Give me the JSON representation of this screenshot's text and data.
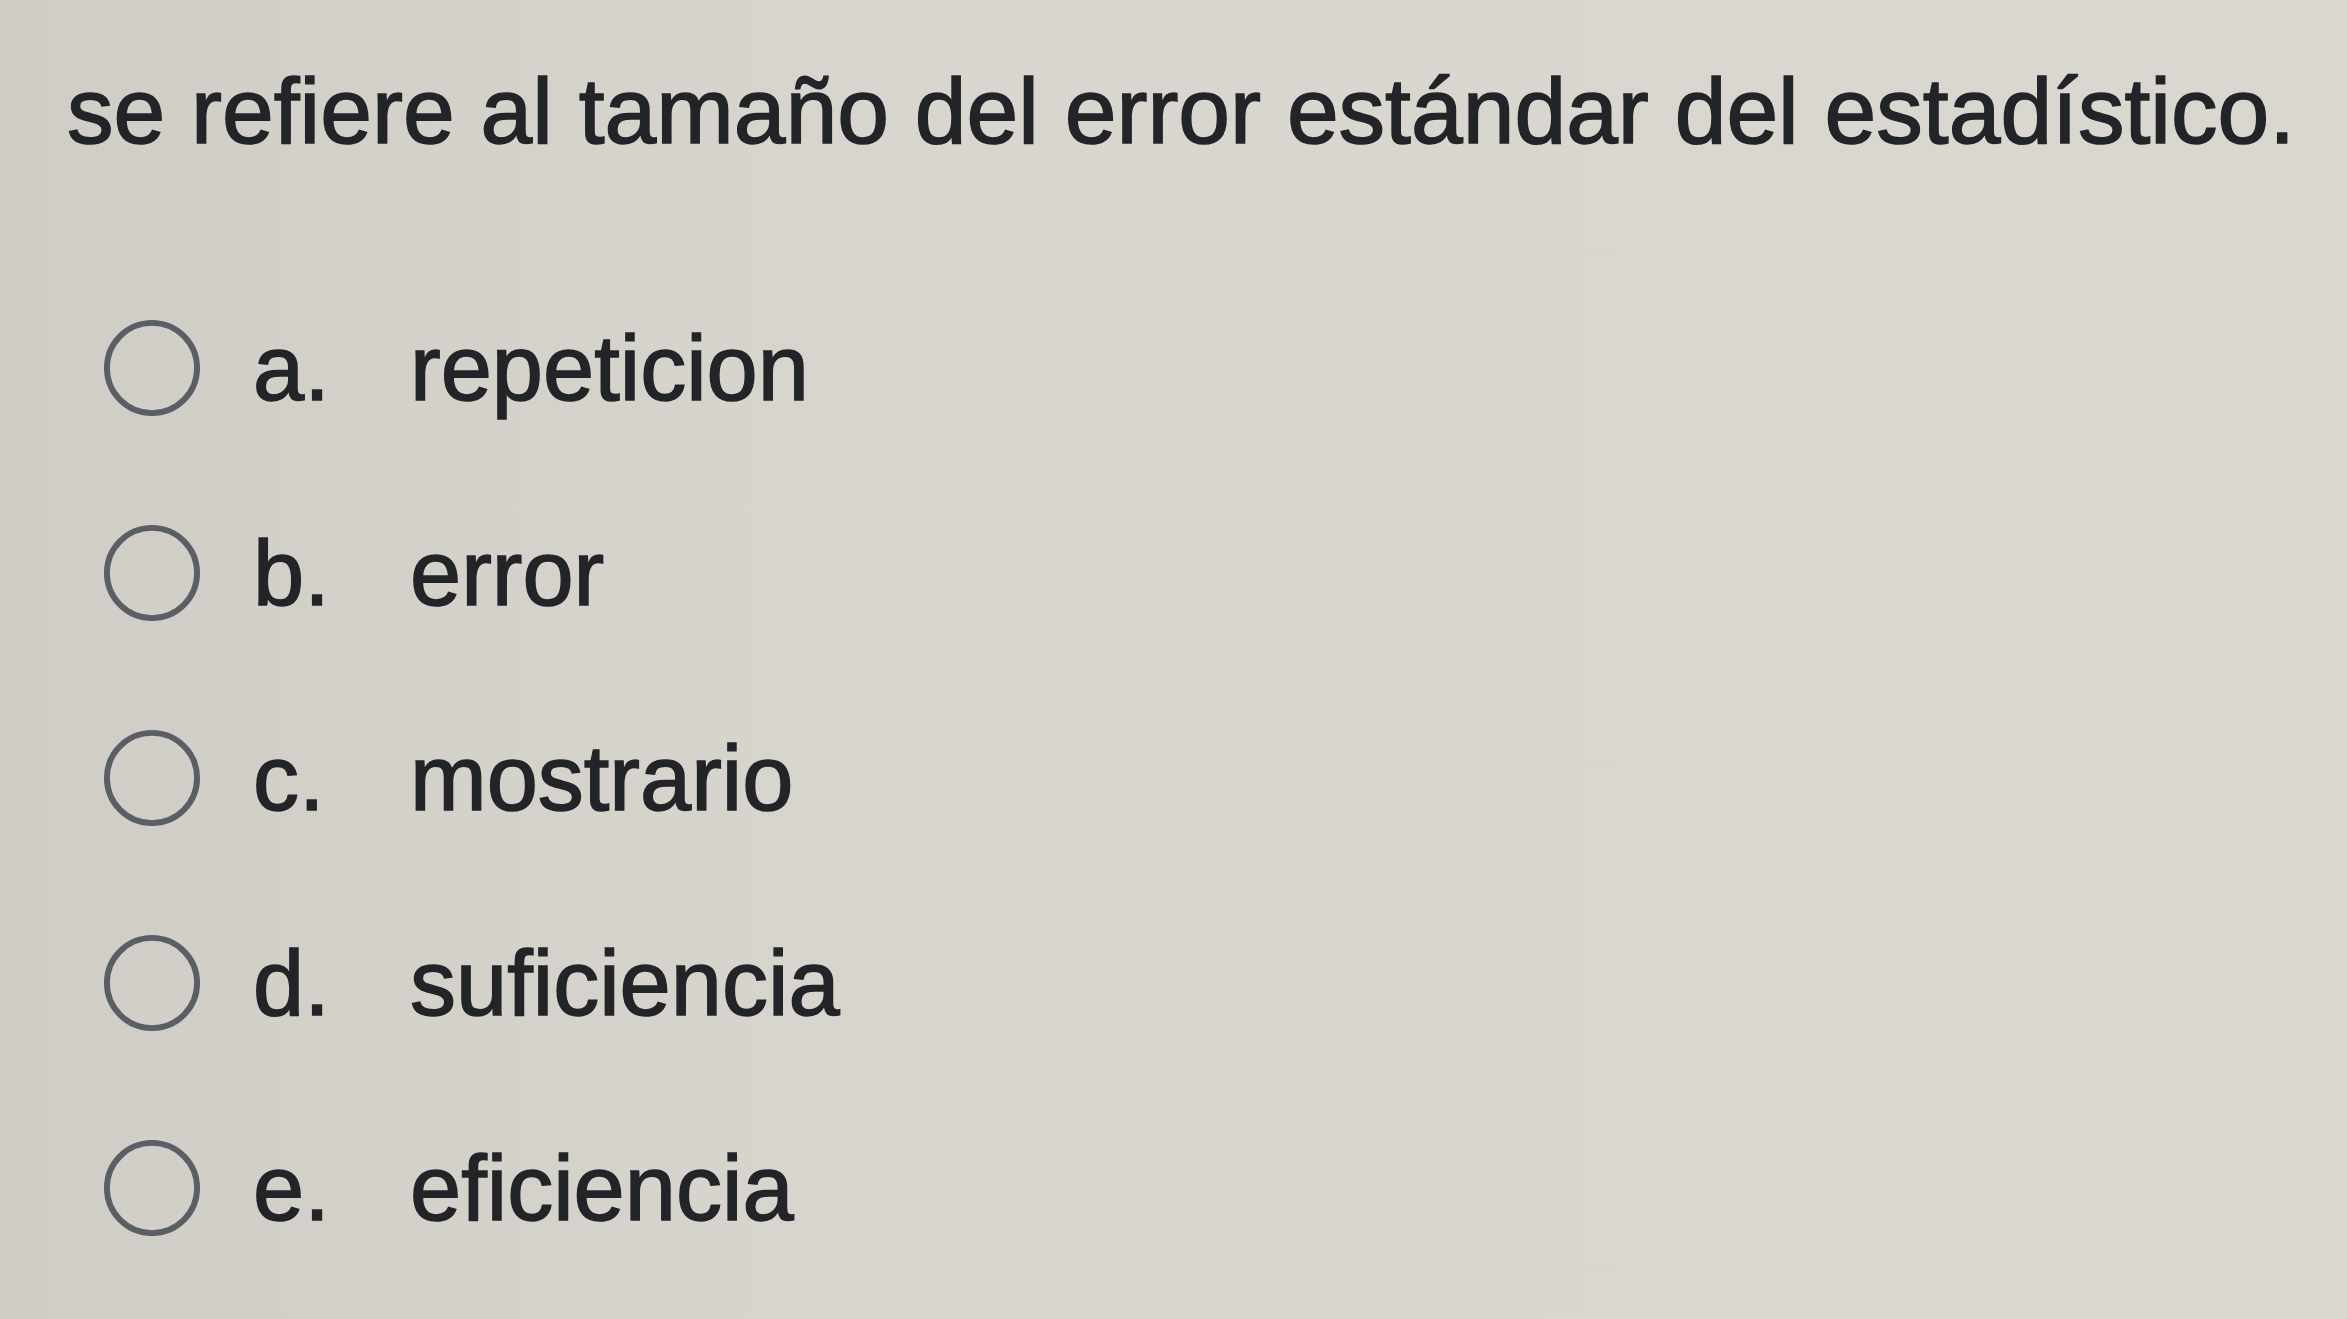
{
  "question": {
    "text": "se refiere al tamaño del error estándar del estadístico."
  },
  "options": [
    {
      "letter": "a.",
      "text": "repeticion",
      "selected": false
    },
    {
      "letter": "b.",
      "text": "error",
      "selected": false
    },
    {
      "letter": "c.",
      "text": "mostrario",
      "selected": false
    },
    {
      "letter": "d.",
      "text": "suficiencia",
      "selected": false
    },
    {
      "letter": "e.",
      "text": "eficiencia",
      "selected": false
    }
  ]
}
